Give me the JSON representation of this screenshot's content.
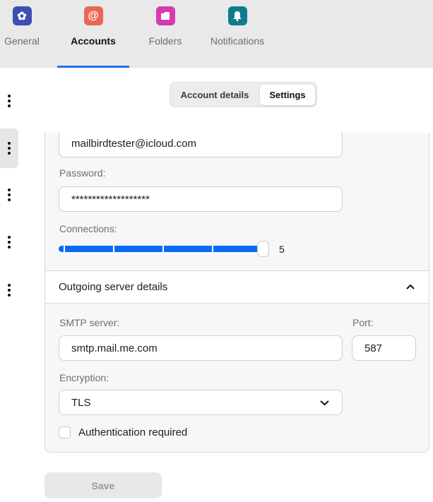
{
  "tabs": [
    {
      "label": "General",
      "icon": "gear-icon",
      "color": "#3d4fb0"
    },
    {
      "label": "Accounts",
      "icon": "at-sign-icon",
      "color": "#e8694f",
      "active": true
    },
    {
      "label": "Folders",
      "icon": "folder-icon",
      "color": "#d43bb0"
    },
    {
      "label": "Notifications",
      "icon": "bell-icon",
      "color": "#0e7c8c"
    }
  ],
  "segmented": {
    "account_details": "Account details",
    "settings": "Settings",
    "selected": "Settings"
  },
  "form": {
    "email": "mailbirdtester@icloud.com",
    "password_label": "Password:",
    "password": "*******************",
    "connections_label": "Connections:",
    "connections_value": "5",
    "connections_max": 5,
    "outgoing_header": "Outgoing server details",
    "smtp_label": "SMTP server:",
    "smtp": "smtp.mail.me.com",
    "port_label": "Port:",
    "port": "587",
    "encryption_label": "Encryption:",
    "encryption": "TLS",
    "auth_label": "Authentication required",
    "auth_checked": false
  },
  "save_label": "Save",
  "accent": "#0a6cf0"
}
